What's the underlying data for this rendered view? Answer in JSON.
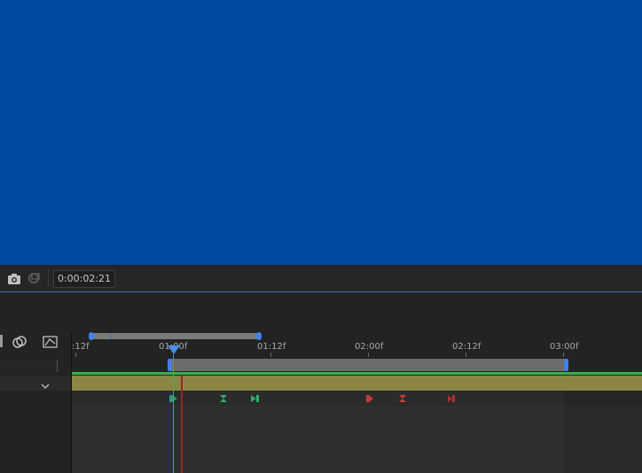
{
  "viewer": {
    "background_color": "#0049a3"
  },
  "toolbar": {
    "icons": [
      "camera-icon",
      "show-snapshot-icon"
    ],
    "timecode": "0:00:02:21"
  },
  "timeline": {
    "ruler_labels": [
      ":12f",
      "01:00f",
      "01:12f",
      "02:00f",
      "02:12f",
      "03:00f"
    ],
    "layer_bar_color": "#8b8646",
    "green_markers": [
      "in-marker",
      "mid-marker",
      "out-marker"
    ],
    "red_markers": [
      "in-marker",
      "mid-marker",
      "out-marker"
    ]
  }
}
